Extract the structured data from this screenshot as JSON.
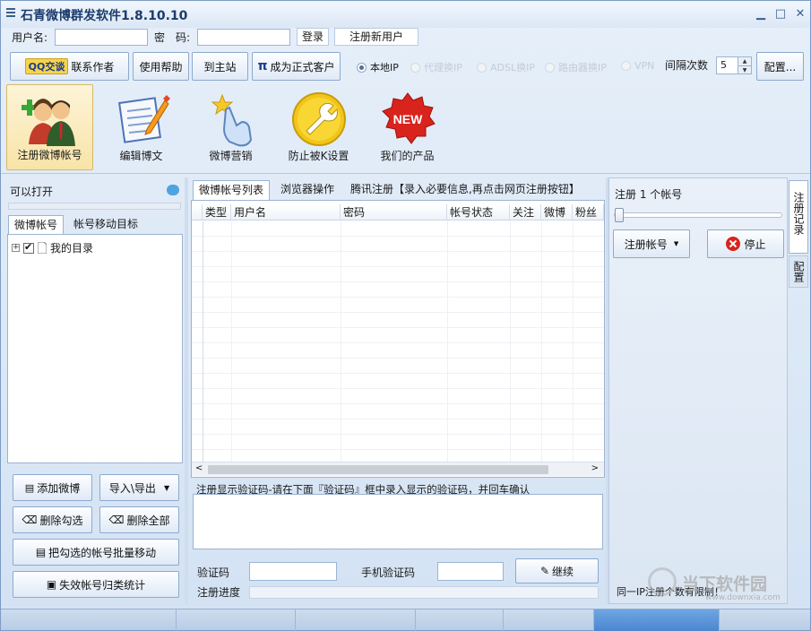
{
  "window": {
    "title": "石青微博群发软件1.8.10.10"
  },
  "login": {
    "username_label": "用户名:",
    "username_value": "",
    "password_label": "密　码:",
    "password_value": "",
    "login_button": "登录",
    "register_button": "注册新用户"
  },
  "toolbar": {
    "qq_badge": "QQ交谈",
    "contact_author": "联系作者",
    "help": "使用帮助",
    "to_site": "到主站",
    "become_customer": "成为正式客户",
    "pi_glyph": "π",
    "ip_options": [
      {
        "label": "本地IP",
        "selected": true,
        "enabled": true
      },
      {
        "label": "代理换IP",
        "selected": false,
        "enabled": false
      },
      {
        "label": "ADSL换IP",
        "selected": false,
        "enabled": false
      },
      {
        "label": "路由器换IP",
        "selected": false,
        "enabled": false
      },
      {
        "label": "VPN",
        "selected": false,
        "enabled": false
      }
    ],
    "interval_label": "间隔次数",
    "interval_value": "5",
    "config_button": "配置..."
  },
  "big_tools": [
    {
      "label": "注册微博帐号",
      "icon": "users-add-icon",
      "active": true
    },
    {
      "label": "编辑博文",
      "icon": "edit-document-icon",
      "active": false
    },
    {
      "label": "微博营销",
      "icon": "hand-star-icon",
      "active": false
    },
    {
      "label": "防止被K设置",
      "icon": "wrench-icon",
      "active": false
    },
    {
      "label": "我们的产品",
      "icon": "new-badge-icon",
      "active": false
    },
    {
      "new_text": "NEW"
    }
  ],
  "left_panel": {
    "status_text": "可以打开",
    "tabs": [
      "微博帐号",
      "帐号移动目标"
    ],
    "tree": [
      {
        "label": "我的目录",
        "checked": true
      }
    ],
    "buttons": {
      "add_weibo": "添加微博",
      "import_export": "导入\\导出",
      "delete_checked": "删除勾选",
      "delete_all": "删除全部",
      "batch_move": "把勾选的帐号批量移动",
      "invalid_stats": "失效帐号归类统计"
    }
  },
  "center_panel": {
    "tabs": [
      "微博帐号列表",
      "浏览器操作",
      "腾讯注册【录入必要信息,再点击网页注册按钮】"
    ],
    "columns": [
      "类型",
      "用户名",
      "密码",
      "帐号状态",
      "关注",
      "微博",
      "粉丝"
    ],
    "captcha_hint": "注册显示验证码-请在下面『验证码』框中录入显示的验证码，并回车确认",
    "captcha_label": "验证码",
    "captcha_value": "",
    "phone_captcha_label": "手机验证码",
    "phone_captcha_value": "",
    "continue_button": "继续",
    "progress_label": "注册进度",
    "progress": 0
  },
  "right_panel": {
    "register_count_text": "注册 1 个帐号",
    "slider_fraction": 0,
    "register_button": "注册帐号",
    "stop_button": "停止",
    "vertical_tabs": [
      "注册记录",
      "配置"
    ],
    "ip_limit_text": "同一IP注册个数有限制！"
  },
  "watermark": {
    "brand": "当下软件园",
    "url": "www.downxia.com"
  },
  "colors": {
    "accent": "#d7b964",
    "border": "#9cb3d1",
    "title": "#1b3c6b",
    "stop_red": "#d9231d"
  }
}
